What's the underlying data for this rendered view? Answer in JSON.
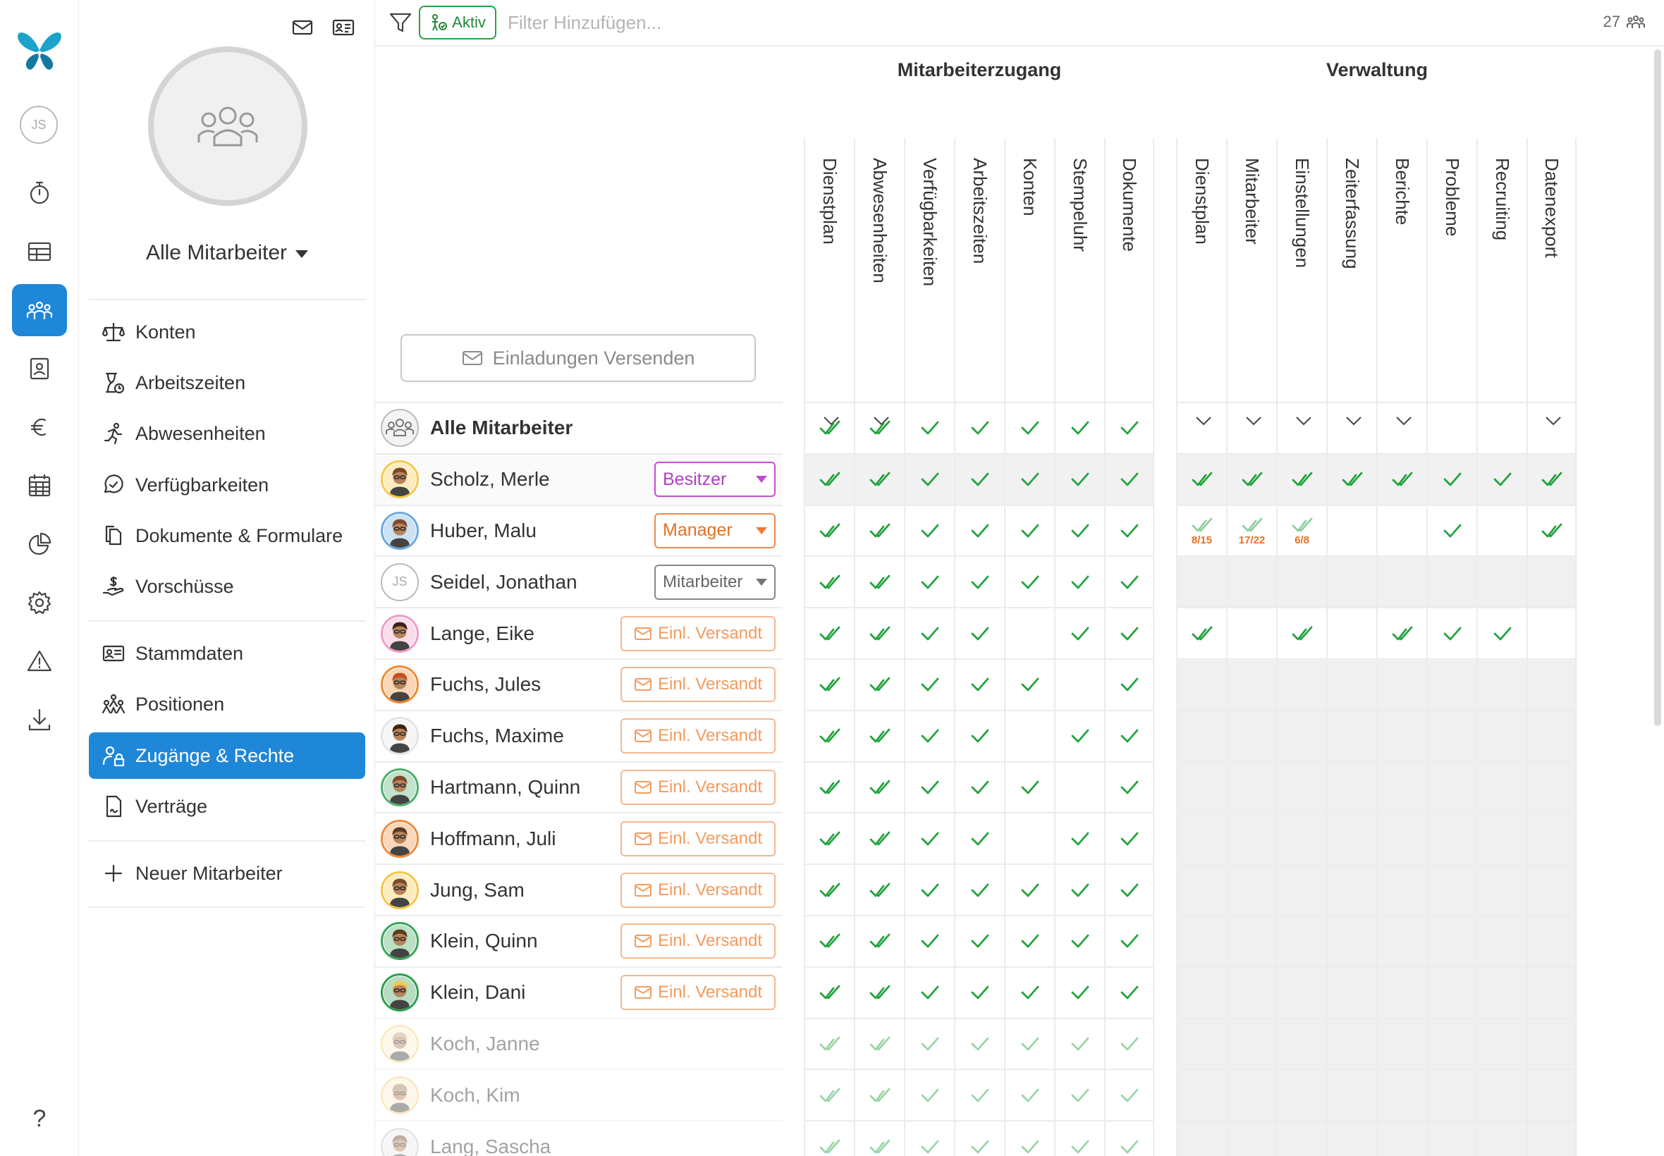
{
  "rail": {
    "user_initials": "JS",
    "items": [
      {
        "icon": "stopwatch-icon",
        "active": false
      },
      {
        "icon": "table-icon",
        "active": false
      },
      {
        "icon": "people-icon",
        "active": true
      },
      {
        "icon": "contact-card-icon",
        "active": false
      },
      {
        "icon": "euro-icon",
        "active": false
      },
      {
        "icon": "calendar-icon",
        "active": false
      },
      {
        "icon": "pie-chart-icon",
        "active": false
      },
      {
        "icon": "gear-icon",
        "active": false
      },
      {
        "icon": "warning-icon",
        "active": false
      },
      {
        "icon": "download-icon",
        "active": false
      }
    ],
    "help_label": "?"
  },
  "panel": {
    "group_name": "Alle Mitarbeiter",
    "menu_a": [
      "Konten",
      "Arbeitszeiten",
      "Abwesenheiten",
      "Verfügbarkeiten",
      "Dokumente & Formulare",
      "Vorschüsse"
    ],
    "menu_b": [
      "Stammdaten",
      "Positionen",
      "Zugänge & Rechte",
      "Verträge"
    ],
    "new_employee": "Neuer Mitarbeiter",
    "active_item": "Zugänge & Rechte"
  },
  "filterbar": {
    "chip_label": "Aktiv",
    "placeholder": "Filter Hinzufügen...",
    "count": "27"
  },
  "invite_button": "Einladungen Versenden",
  "groups": {
    "mitarbeiterzugang": {
      "title": "Mitarbeiterzugang",
      "columns": [
        "Dienstplan",
        "Abwesenheiten",
        "Verfügbarkeiten",
        "Arbeitszeiten",
        "Konten",
        "Stempeluhr",
        "Dokumente"
      ],
      "dropdown": [
        true,
        true,
        false,
        false,
        false,
        false,
        false
      ]
    },
    "verwaltung": {
      "title": "Verwaltung",
      "columns": [
        "Dienstplan",
        "Mitarbeiter",
        "Einstellungen",
        "Zeiterfassung",
        "Berichte",
        "Probleme",
        "Recruiting",
        "Datenexport"
      ],
      "dropdown": [
        true,
        true,
        true,
        true,
        true,
        false,
        false,
        true
      ]
    }
  },
  "colors": {
    "accent": "#1f87d8",
    "check": "#22a33e",
    "besitzer": "#b23ec4",
    "manager": "#e8701f",
    "invite": "#f49b5e"
  },
  "rows": [
    {
      "name": "Alle Mitarbeiter",
      "role": "",
      "role_type": "none",
      "avatar": "group",
      "bold": true,
      "disabled": false,
      "ma": [
        "dd",
        "dd",
        "c",
        "c",
        "c",
        "c",
        "c"
      ],
      "vw": [
        "",
        "",
        "",
        "",
        "",
        "",
        "",
        ""
      ],
      "vw_grey": false,
      "highlight": false
    },
    {
      "name": "Scholz, Merle",
      "role": "Besitzer",
      "role_type": "besitzer",
      "avatar": "yellow",
      "bold": false,
      "disabled": false,
      "ma": [
        "dd",
        "dd",
        "c",
        "c",
        "c",
        "c",
        "c"
      ],
      "vw": [
        "dd",
        "dd",
        "dd",
        "dd",
        "dd",
        "c",
        "c",
        "dd"
      ],
      "vw_grey": false,
      "highlight": true
    },
    {
      "name": "Huber, Malu",
      "role": "Manager",
      "role_type": "manager",
      "avatar": "blue",
      "bold": false,
      "disabled": false,
      "ma": [
        "dd",
        "dd",
        "c",
        "c",
        "c",
        "c",
        "c"
      ],
      "vw": [
        "p:8/15",
        "p:17/22",
        "p:6/8",
        "",
        "",
        "c",
        "",
        "dd"
      ],
      "vw_grey": false,
      "highlight": false
    },
    {
      "name": "Seidel, Jonathan",
      "role": "Mitarbeiter",
      "role_type": "mitarbeiter",
      "avatar": "initials",
      "initials": "JS",
      "bold": false,
      "disabled": false,
      "ma": [
        "dd",
        "dd",
        "c",
        "c",
        "c",
        "c",
        "c"
      ],
      "vw": [
        "",
        "",
        "",
        "",
        "",
        "",
        "",
        ""
      ],
      "vw_grey": true,
      "highlight": false
    },
    {
      "name": "Lange, Eike",
      "role": "Einl. Versandt",
      "role_type": "einl",
      "avatar": "pink",
      "bold": false,
      "disabled": false,
      "ma": [
        "dd",
        "dd",
        "c",
        "c",
        "",
        "c",
        "c"
      ],
      "vw": [
        "dd",
        "",
        "dd",
        "",
        "dd",
        "c",
        "c",
        ""
      ],
      "vw_grey": false,
      "highlight": false
    },
    {
      "name": "Fuchs, Jules",
      "role": "Einl. Versandt",
      "role_type": "einl",
      "avatar": "orange",
      "bold": false,
      "disabled": false,
      "ma": [
        "dd",
        "dd",
        "c",
        "c",
        "c",
        "",
        "c"
      ],
      "vw": [
        "",
        "",
        "",
        "",
        "",
        "",
        "",
        ""
      ],
      "vw_grey": true,
      "highlight": false
    },
    {
      "name": "Fuchs, Maxime",
      "role": "Einl. Versandt",
      "role_type": "einl",
      "avatar": "hat",
      "bold": false,
      "disabled": false,
      "ma": [
        "dd",
        "dd",
        "c",
        "c",
        "",
        "c",
        "c"
      ],
      "vw": [
        "",
        "",
        "",
        "",
        "",
        "",
        "",
        ""
      ],
      "vw_grey": true,
      "highlight": false
    },
    {
      "name": "Hartmann, Quinn",
      "role": "Einl. Versandt",
      "role_type": "einl",
      "avatar": "green",
      "bold": false,
      "disabled": false,
      "ma": [
        "dd",
        "dd",
        "c",
        "c",
        "c",
        "",
        "c"
      ],
      "vw": [
        "",
        "",
        "",
        "",
        "",
        "",
        "",
        ""
      ],
      "vw_grey": true,
      "highlight": false
    },
    {
      "name": "Hoffmann, Juli",
      "role": "Einl. Versandt",
      "role_type": "einl",
      "avatar": "orange2",
      "bold": false,
      "disabled": false,
      "ma": [
        "dd",
        "dd",
        "c",
        "c",
        "",
        "c",
        "c"
      ],
      "vw": [
        "",
        "",
        "",
        "",
        "",
        "",
        "",
        ""
      ],
      "vw_grey": true,
      "highlight": false
    },
    {
      "name": "Jung, Sam",
      "role": "Einl. Versandt",
      "role_type": "einl",
      "avatar": "yellow2",
      "bold": false,
      "disabled": false,
      "ma": [
        "dd",
        "dd",
        "c",
        "c",
        "c",
        "c",
        "c"
      ],
      "vw": [
        "",
        "",
        "",
        "",
        "",
        "",
        "",
        ""
      ],
      "vw_grey": true,
      "highlight": false
    },
    {
      "name": "Klein, Quinn",
      "role": "Einl. Versandt",
      "role_type": "einl",
      "avatar": "green2",
      "bold": false,
      "disabled": false,
      "ma": [
        "dd",
        "dd",
        "c",
        "c",
        "c",
        "c",
        "c"
      ],
      "vw": [
        "",
        "",
        "",
        "",
        "",
        "",
        "",
        ""
      ],
      "vw_grey": true,
      "highlight": false
    },
    {
      "name": "Klein, Dani",
      "role": "Einl. Versandt",
      "role_type": "einl",
      "avatar": "green3",
      "bold": false,
      "disabled": false,
      "ma": [
        "dd",
        "dd",
        "c",
        "c",
        "c",
        "c",
        "c"
      ],
      "vw": [
        "",
        "",
        "",
        "",
        "",
        "",
        "",
        ""
      ],
      "vw_grey": true,
      "highlight": false
    },
    {
      "name": "Koch, Janne",
      "role": "",
      "role_type": "none",
      "avatar": "yellow3",
      "bold": false,
      "disabled": true,
      "ma": [
        "dd",
        "dd",
        "c",
        "c",
        "c",
        "c",
        "c"
      ],
      "vw": [
        "",
        "",
        "",
        "",
        "",
        "",
        "",
        ""
      ],
      "vw_grey": true,
      "highlight": false
    },
    {
      "name": "Koch, Kim",
      "role": "",
      "role_type": "none",
      "avatar": "yellow4",
      "bold": false,
      "disabled": true,
      "ma": [
        "dd",
        "dd",
        "c",
        "c",
        "c",
        "c",
        "c"
      ],
      "vw": [
        "",
        "",
        "",
        "",
        "",
        "",
        "",
        ""
      ],
      "vw_grey": true,
      "highlight": false
    },
    {
      "name": "Lang, Sascha",
      "role": "",
      "role_type": "none",
      "avatar": "grey",
      "bold": false,
      "disabled": true,
      "ma": [
        "dd",
        "dd",
        "c",
        "c",
        "c",
        "c",
        "c"
      ],
      "vw": [
        "",
        "",
        "",
        "",
        "",
        "",
        "",
        ""
      ],
      "vw_grey": true,
      "highlight": false
    }
  ]
}
